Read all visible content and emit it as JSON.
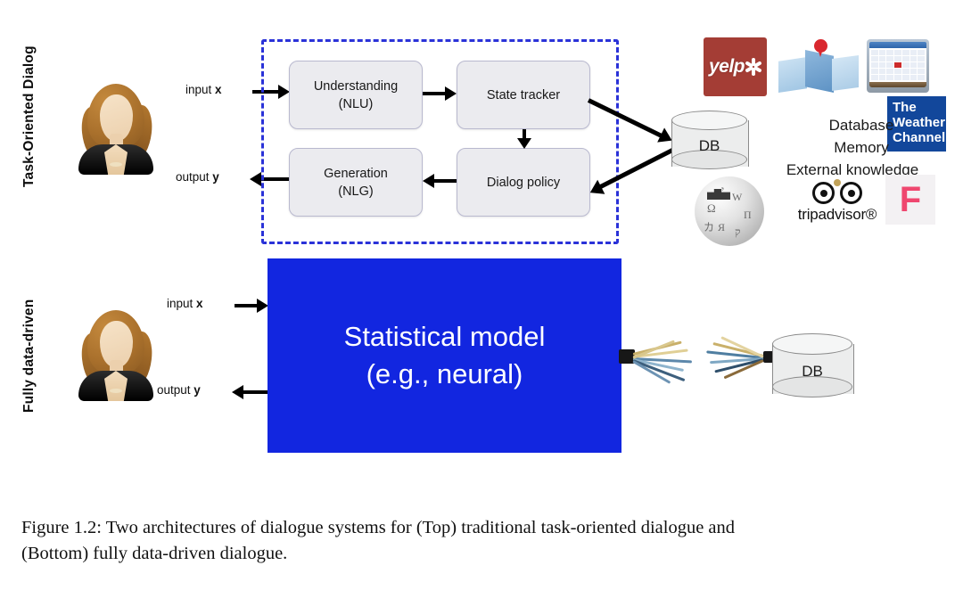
{
  "figure": {
    "rows": [
      {
        "label": "Task-Oriented Dialog"
      },
      {
        "label": "Fully data-driven"
      }
    ],
    "io": {
      "input_prefix": "input ",
      "input_var": "x",
      "output_prefix": "output ",
      "output_var": "y"
    },
    "top_pipeline": {
      "boxes": [
        {
          "name": "nlu",
          "line1": "Understanding",
          "line2": "(NLU)"
        },
        {
          "name": "state-tracker",
          "line1": "State tracker",
          "line2": ""
        },
        {
          "name": "nlg",
          "line1": "Generation",
          "line2": "(NLG)"
        },
        {
          "name": "dialog-policy",
          "line1": "Dialog policy",
          "line2": ""
        }
      ]
    },
    "database": {
      "label": "DB"
    },
    "knowledge": {
      "lines": [
        "Database",
        "Memory",
        "External knowledge"
      ]
    },
    "logos": [
      {
        "name": "yelp-logo",
        "text": "yelp",
        "color": "#a43d35"
      },
      {
        "name": "map-icon",
        "text": "",
        "color": "#8fb8dd"
      },
      {
        "name": "calendar-icon",
        "text": "",
        "color": "#2e66ab"
      },
      {
        "name": "weather-channel-logo",
        "text": "The Weather Channel",
        "color": "#12479b"
      },
      {
        "name": "wikipedia-logo",
        "text": "",
        "color": "#b7b7b7"
      },
      {
        "name": "tripadvisor-logo",
        "text": "tripadvisor",
        "color": "#111111"
      },
      {
        "name": "foursquare-logo",
        "text": "F",
        "color": "#ef476f"
      }
    ],
    "weather_channel": {
      "l1": "The",
      "l2": "Weather",
      "l3": "Channel"
    },
    "tripadvisor": {
      "wordmark": "tripadvisor®"
    },
    "foursquare": {
      "glyph": "F"
    },
    "bottom": {
      "model_line1": "Statistical model",
      "model_line2": "(e.g., neural)",
      "model_color": "#1226e0",
      "db_label": "DB"
    },
    "dashed_border_color": "#2a32d8"
  },
  "caption": {
    "line1": "Figure 1.2:  Two architectures of dialogue systems for (Top) traditional task-oriented dialogue and",
    "line2": "(Bottom) fully data-driven dialogue."
  }
}
